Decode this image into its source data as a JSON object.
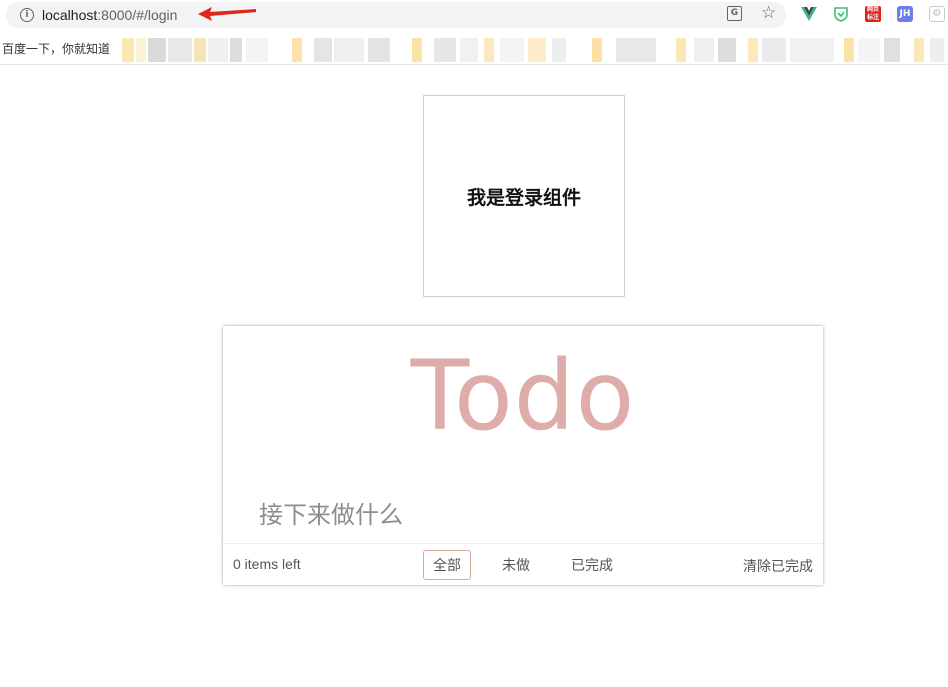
{
  "browser": {
    "url_host": "localhost",
    "url_path": ":8000/#/login",
    "ext_red_label": "网页标注",
    "ext_jh_label": "JH",
    "bookmark_label": "百度一下，你就知道",
    "annotation_color": "#e0251b"
  },
  "login": {
    "heading": "我是登录组件"
  },
  "todo": {
    "title": "Todo",
    "input_placeholder": "接下来做什么",
    "items_left": "0 items left",
    "filters": [
      {
        "label": "全部",
        "active": true
      },
      {
        "label": "未做",
        "active": false
      },
      {
        "label": "已完成",
        "active": false
      }
    ],
    "clear_completed": "清除已完成",
    "accent_color": "#deadaa"
  }
}
